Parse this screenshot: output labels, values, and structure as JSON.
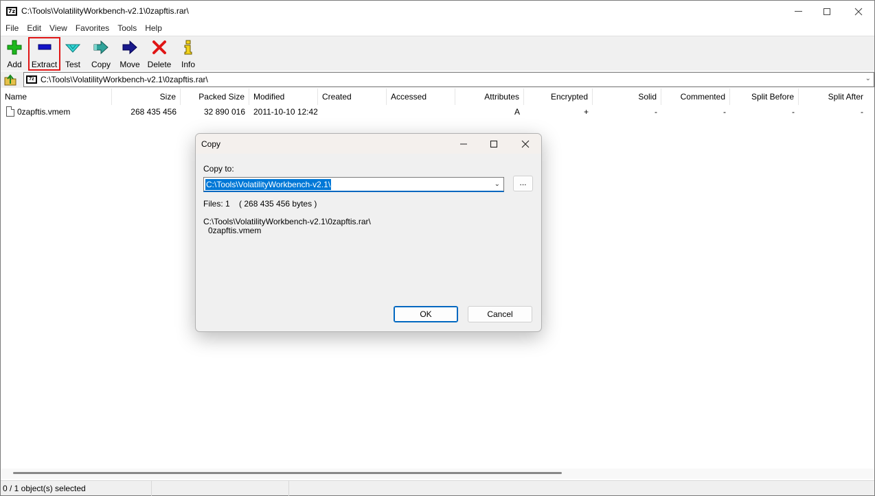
{
  "window": {
    "title": "C:\\Tools\\VolatilityWorkbench-v2.1\\0zapftis.rar\\",
    "app_icon_text": "7z"
  },
  "menu": [
    "File",
    "Edit",
    "View",
    "Favorites",
    "Tools",
    "Help"
  ],
  "toolbar": {
    "add": "Add",
    "extract": "Extract",
    "test": "Test",
    "copy": "Copy",
    "move": "Move",
    "delete": "Delete",
    "info": "Info",
    "highlighted": "Extract",
    "highlight_color": "#e01515"
  },
  "address": {
    "path": "C:\\Tools\\VolatilityWorkbench-v2.1\\0zapftis.rar\\"
  },
  "list": {
    "columns": [
      "Name",
      "Size",
      "Packed Size",
      "Modified",
      "Created",
      "Accessed",
      "Attributes",
      "Encrypted",
      "Solid",
      "Commented",
      "Split Before",
      "Split After"
    ],
    "rows": [
      {
        "name": "0zapftis.vmem",
        "size": "268 435 456",
        "packed_size": "32 890 016",
        "modified": "2011-10-10 12:42",
        "created": "",
        "accessed": "",
        "attributes": "A",
        "encrypted": "+",
        "solid": "-",
        "commented": "-",
        "split_before": "-",
        "split_after": "-"
      }
    ]
  },
  "status": {
    "selection": "0 / 1 object(s) selected"
  },
  "dialog": {
    "title": "Copy",
    "copy_to_label": "Copy to:",
    "copy_to_value": "C:\\Tools\\VolatilityWorkbench-v2.1\\",
    "browse_label": "...",
    "files_info": "Files: 1    ( 268 435 456 bytes )",
    "source_path": "C:\\Tools\\VolatilityWorkbench-v2.1\\0zapftis.rar\\",
    "source_file": "0zapftis.vmem",
    "ok_label": "OK",
    "cancel_label": "Cancel"
  }
}
